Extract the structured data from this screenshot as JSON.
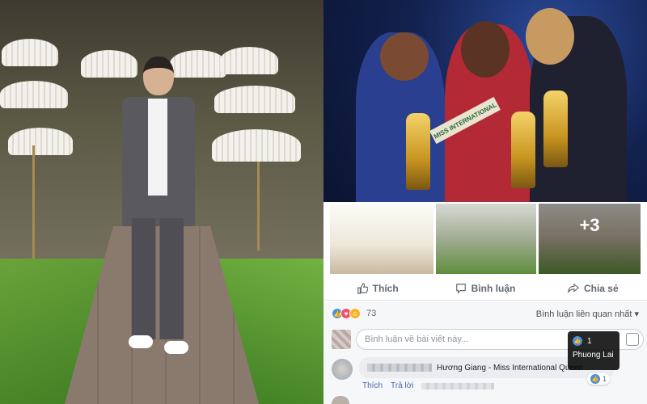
{
  "post": {
    "thumbnail_more": "+3"
  },
  "actions": {
    "like": "Thích",
    "comment": "Bình luận",
    "share": "Chia sẻ"
  },
  "reactions": {
    "count": "73",
    "sort_label": "Bình luận liên quan nhất ▾"
  },
  "composer": {
    "placeholder": "Bình luận về bài viết này..."
  },
  "tooltip": {
    "count": "1",
    "name": "Phuong Lai"
  },
  "comment": {
    "text": "Hương Giang - Miss International Queen",
    "like": "Thích",
    "reply": "Trả lời",
    "like_count": "1"
  },
  "sash_text": "MISS INTERNATIONAL",
  "colors": {
    "link": "#4267b2",
    "like_blue": "#4a90e2",
    "love_red": "#f25268",
    "haha_yellow": "#f7b125"
  }
}
